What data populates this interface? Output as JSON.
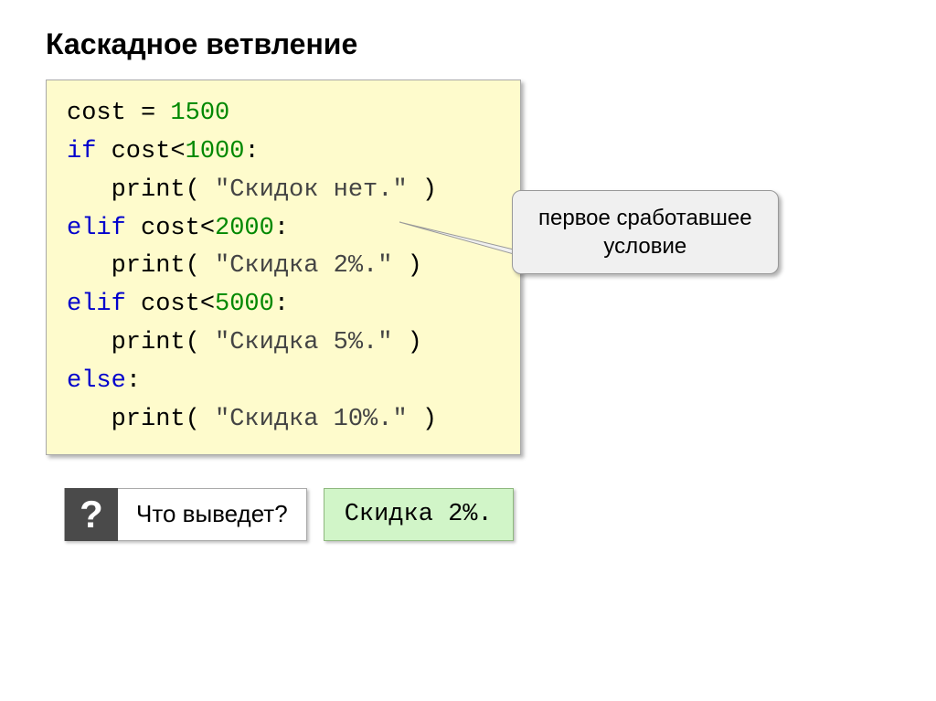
{
  "title": "Каскадное ветвление",
  "code": {
    "l1_id": "cost",
    "l1_op": " = ",
    "l1_num": "1500",
    "l2_if": "if",
    "l2_id": " cost",
    "l2_lt": "<",
    "l2_num": "1000",
    "l2_colon": ":",
    "l3_print": "   print",
    "l3_open": "( ",
    "l3_str": "\"Скидок нет.\"",
    "l3_close": " )",
    "l4_elif": "elif",
    "l4_id": " cost",
    "l4_lt": "<",
    "l4_num": "2000",
    "l4_colon": ":",
    "l5_print": "   print",
    "l5_open": "( ",
    "l5_str": "\"Скидка 2%.\"",
    "l5_close": " )",
    "l6_elif": "elif",
    "l6_id": " cost",
    "l6_lt": "<",
    "l6_num": "5000",
    "l6_colon": ":",
    "l7_print": "   print",
    "l7_open": "( ",
    "l7_str": "\"Скидка 5%.\"",
    "l7_close": " )",
    "l8_else": "else",
    "l8_colon": ":",
    "l9_print": "   print",
    "l9_open": "( ",
    "l9_str": "\"Скидка 10%.\"",
    "l9_close": " )"
  },
  "callout": {
    "line1": "первое сработавшее",
    "line2": "условие"
  },
  "question": {
    "mark": "?",
    "text": "Что выведет?"
  },
  "answer": "Скидка 2%."
}
